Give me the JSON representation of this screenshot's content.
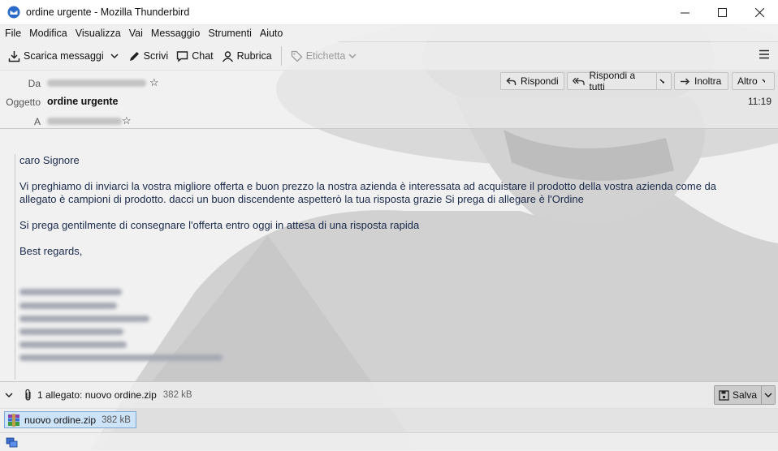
{
  "window": {
    "title": "ordine urgente - Mozilla Thunderbird"
  },
  "menubar": [
    {
      "label": "File"
    },
    {
      "label": "Modifica"
    },
    {
      "label": "Visualizza"
    },
    {
      "label": "Vai"
    },
    {
      "label": "Messaggio"
    },
    {
      "label": "Strumenti"
    },
    {
      "label": "Aiuto"
    }
  ],
  "toolbar": {
    "get_messages": "Scarica messaggi",
    "write": "Scrivi",
    "chat": "Chat",
    "address_book": "Rubrica",
    "tag": "Etichetta"
  },
  "header": {
    "from_label": "Da",
    "subject_label": "Oggetto",
    "to_label": "A",
    "subject": "ordine urgente",
    "time": "11:19",
    "reply": "Rispondi",
    "reply_all": "Rispondi a tutti",
    "forward": "Inoltra",
    "other": "Altro"
  },
  "body": {
    "greeting": "caro Signore",
    "paragraph1": "Vi preghiamo di inviarci la vostra migliore offerta e buon prezzo la nostra azienda è interessata ad acquistare il prodotto della vostra azienda come da allegato è campioni di prodotto. dacci un buon discendente aspetterò la tua risposta grazie Si prega di allegare è l'Ordine",
    "paragraph2": "Si prega gentilmente di consegnare l'offerta entro oggi in attesa di una risposta rapida",
    "closing": "Best regards,"
  },
  "attachments": {
    "summary": "1 allegato: nuovo ordine.zip",
    "summary_size": "382 kB",
    "save": "Salva",
    "items": [
      {
        "name": "nuovo ordine.zip",
        "size": "382 kB"
      }
    ]
  },
  "colors": {
    "link_text": "#1b2a4a",
    "selection": "#cde3f7"
  }
}
